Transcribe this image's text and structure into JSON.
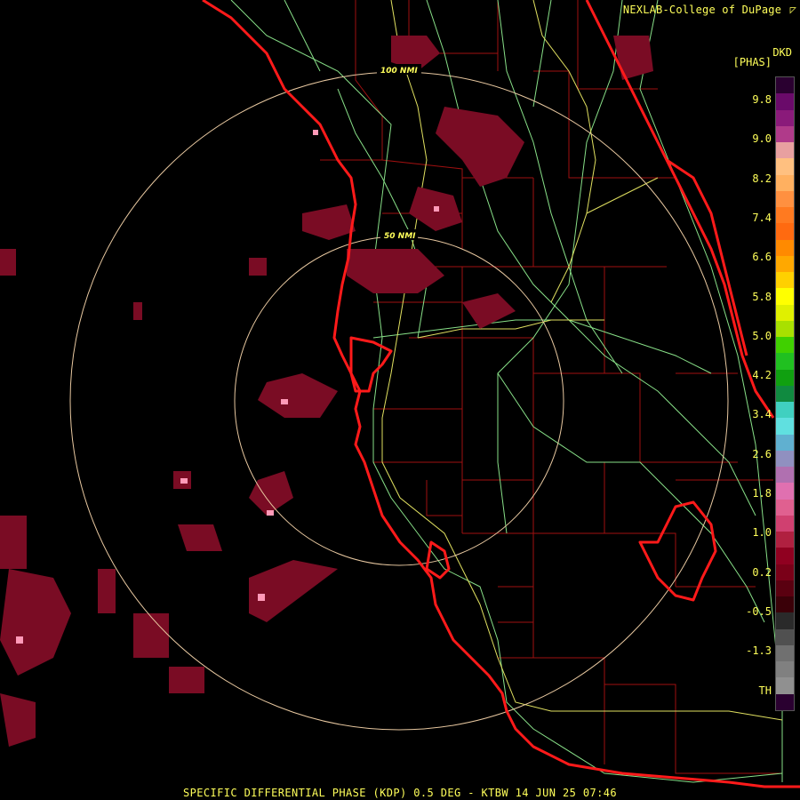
{
  "credit": {
    "text": "NEXLAB-College of DuPage",
    "mark": "◸"
  },
  "legend": {
    "product": "DKD",
    "unit": "[PHAS]",
    "ticks": [
      "9.8",
      "9.0",
      "8.2",
      "7.4",
      "6.6",
      "5.8",
      "5.0",
      "4.2",
      "3.4",
      "2.6",
      "1.8",
      "1.0",
      "0.2",
      "-0.5",
      "-1.3",
      "TH"
    ],
    "colors": [
      "#2a0030",
      "#6a0a6a",
      "#8a1a7a",
      "#b03a8a",
      "#e8a0a0",
      "#ffc080",
      "#ffb060",
      "#ff9040",
      "#ff7a20",
      "#ff6a10",
      "#ff8a00",
      "#ffa800",
      "#ffd000",
      "#ffff00",
      "#e0f000",
      "#a8e000",
      "#40d000",
      "#20c020",
      "#10a010",
      "#108a40",
      "#40d0c0",
      "#60e0e0",
      "#60b0d0",
      "#9090c0",
      "#b070b0",
      "#e070b0",
      "#e06090",
      "#d04070",
      "#b02040",
      "#900020",
      "#7a0018",
      "#5a0010",
      "#3a0008",
      "#2a2a2a",
      "#505050",
      "#707070",
      "#808080",
      "#909090",
      "#2a0030"
    ]
  },
  "rings": [
    {
      "label": "100 NMI"
    },
    {
      "label": "50 NMI"
    }
  ],
  "caption": "SPECIFIC DIFFERENTIAL PHASE (KDP) 0.5 DEG - KTBW 14 JUN 25 07:46",
  "colors": {
    "background": "#000000",
    "coast": "#ff1a1a",
    "county": "#a01010",
    "roads_green": "#88e088",
    "roads_yellow": "#e0e060",
    "ring": "#e8c8a0",
    "echo": "#7a0c24",
    "echo_bright": "#ff9ab8"
  }
}
